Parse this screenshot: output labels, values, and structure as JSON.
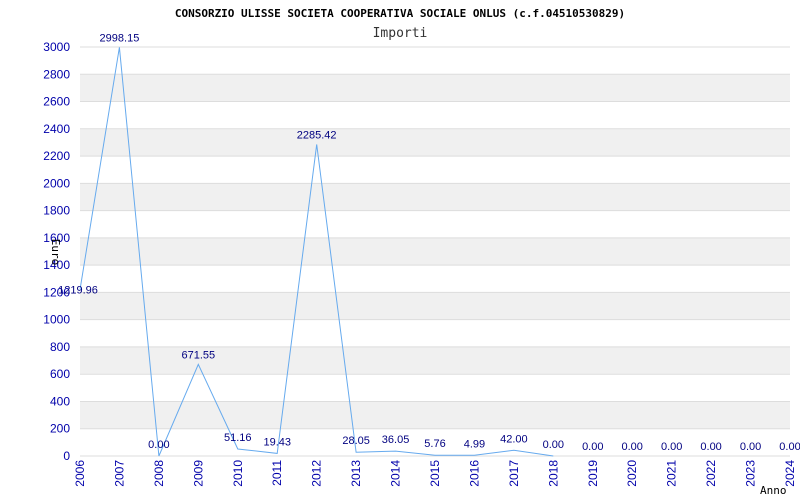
{
  "chart_data": {
    "type": "line",
    "title": "CONSORZIO ULISSE SOCIETA COOPERATIVA SOCIALE ONLUS (c.f.04510530829)",
    "subtitle": "Importi",
    "xlabel": "Anno",
    "ylabel": "Euro",
    "ylim": [
      0,
      3000
    ],
    "yticks": [
      0,
      200,
      400,
      600,
      800,
      1000,
      1200,
      1400,
      1600,
      1800,
      2000,
      2200,
      2400,
      2600,
      2800,
      3000
    ],
    "x": [
      "2006",
      "2007",
      "2008",
      "2009",
      "2010",
      "2011",
      "2012",
      "2013",
      "2014",
      "2015",
      "2016",
      "2017",
      "2018",
      "2019",
      "2020",
      "2021",
      "2022",
      "2023",
      "2024"
    ],
    "values": [
      1219.96,
      2998.15,
      0.0,
      671.55,
      51.16,
      19.43,
      2285.42,
      28.05,
      36.05,
      5.76,
      4.99,
      42.0,
      0.0,
      null,
      null,
      null,
      null,
      null,
      null
    ],
    "data_labels": [
      "1219.96",
      "2998.15",
      "0.00",
      "671.55",
      "51.16",
      "19.43",
      "2285.42",
      "28.05",
      "36.05",
      "5.76",
      "4.99",
      "42.00",
      "0.00",
      "0.00",
      "0.00",
      "0.00",
      "0.00",
      "0.00",
      "0.00"
    ],
    "grid": true,
    "colors": {
      "line": "#66aaee",
      "band": "#f0f0f0",
      "tick_text": "#0000aa",
      "label_text": "#000080"
    }
  }
}
